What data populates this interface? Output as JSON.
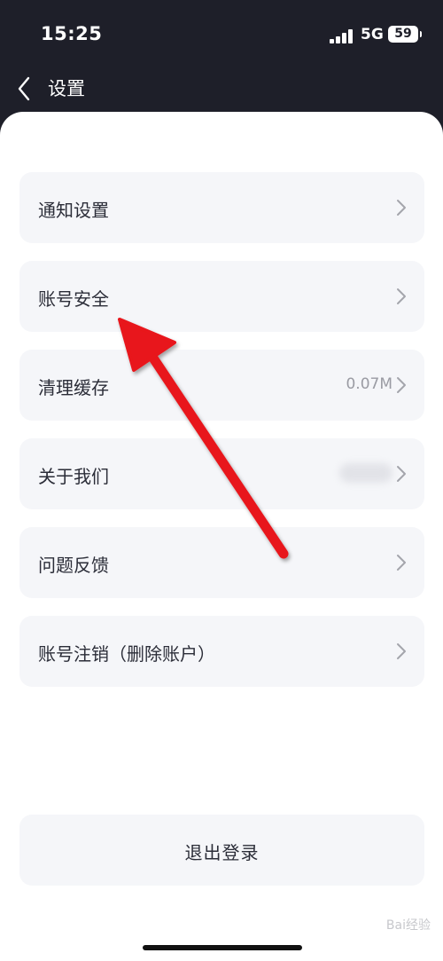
{
  "status_bar": {
    "time": "15:25",
    "network": "5G",
    "battery": "59"
  },
  "navbar": {
    "title": "设置"
  },
  "settings": {
    "items": [
      {
        "label": "通知设置",
        "value": ""
      },
      {
        "label": "账号安全",
        "value": ""
      },
      {
        "label": "清理缓存",
        "value": "0.07M"
      },
      {
        "label": "关于我们",
        "value": ""
      },
      {
        "label": "问题反馈",
        "value": ""
      },
      {
        "label": "账号注销（删除账户）",
        "value": ""
      }
    ]
  },
  "logout": {
    "label": "退出登录"
  },
  "watermark": {
    "text": "Bai经验"
  },
  "colors": {
    "header_bg": "#1e1f29",
    "row_bg": "#f5f6f9",
    "arrow": "#e8141a"
  }
}
